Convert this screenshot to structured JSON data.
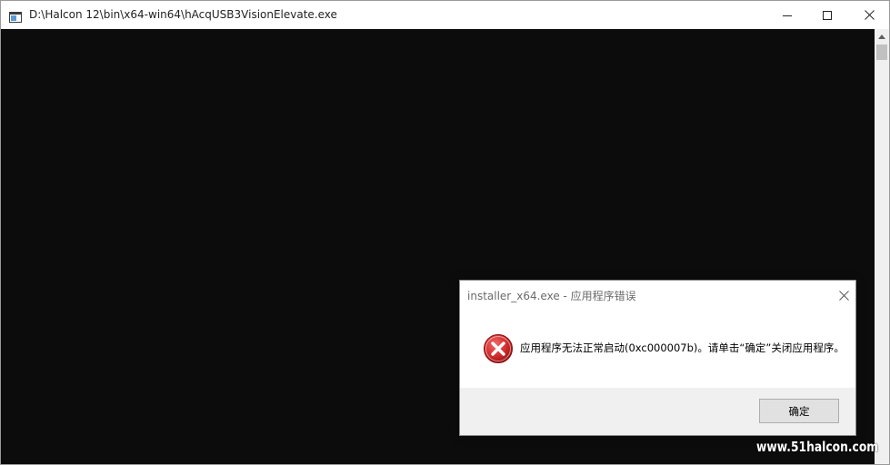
{
  "console_window": {
    "title": "D:\\Halcon 12\\bin\\x64-win64\\hAcqUSB3VisionElevate.exe",
    "background_color": "#0c0c0c"
  },
  "error_dialog": {
    "title": "installer_x64.exe - 应用程序错误",
    "message": "应用程序无法正常启动(0xc000007b)。请单击“确定”关闭应用程序。",
    "ok_label": "确定",
    "icon": "error-icon",
    "icon_color": "#d32f2f"
  },
  "watermark": {
    "text": "www.51halcon.com"
  }
}
